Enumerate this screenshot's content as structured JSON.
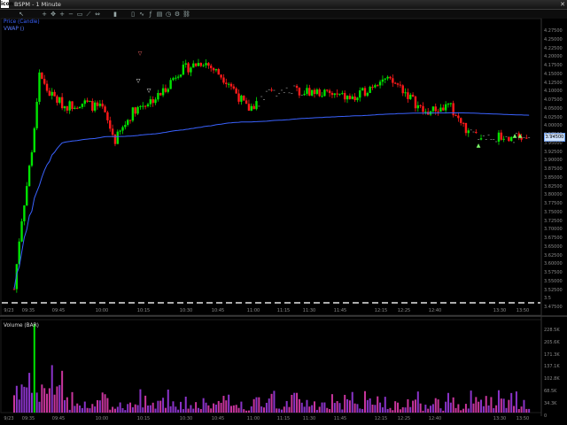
{
  "window": {
    "app_icon": "icon",
    "title": "BSPM - 1 Minute",
    "close_glyph": "✕"
  },
  "toolbar": {
    "icons": [
      "arrow-pointer-icon",
      "crosshair-icon",
      "pan-icon",
      "zoom-in-icon",
      "zoom-out-icon",
      "zoom-box-icon",
      "draw-line-icon",
      "fit-icon",
      "bar-style-icon",
      "candle-style-icon",
      "line-style-icon",
      "indicator-icon",
      "template-icon",
      "period-icon",
      "settings-icon",
      "link-icon"
    ],
    "glyphs": [
      "↖",
      "+",
      "✥",
      "+",
      "−",
      "▭",
      "⟋",
      "⇔",
      "▮",
      "▯",
      "∿",
      "ƒ",
      "▤",
      "◷",
      "⚙",
      "⛓"
    ]
  },
  "price_pane": {
    "study_label": "Price (Candle)",
    "vwap_label": "VWAP ()",
    "price_ticks": [
      "4.27500",
      "4.25000",
      "4.22500",
      "4.20000",
      "4.17500",
      "4.15000",
      "4.12500",
      "4.10000",
      "4.07500",
      "4.05000",
      "4.02500",
      "4.00000",
      "3.97500",
      "3.95000",
      "3.92500",
      "3.90000",
      "3.87500",
      "3.85000",
      "3.82500",
      "3.80000",
      "3.77500",
      "3.75000",
      "3.72500",
      "3.70000",
      "3.67500",
      "3.65000",
      "3.62500",
      "3.60000",
      "3.57500",
      "3.55000",
      "3.52500",
      "3.5",
      "3.47500"
    ],
    "time_ticks": [
      "9/23",
      "09:35",
      "09:45",
      "10:00",
      "10:15",
      "10:30",
      "10:45",
      "11:00",
      "11:15",
      "11:30",
      "11:45",
      "12:15",
      "12:25",
      "12:40",
      "13:30",
      "13:50"
    ],
    "last_price": "3.94500",
    "colors": {
      "up": "#00e400",
      "down": "#ff1a1a",
      "vwap": "#3a62ff",
      "line": "#e6e6e6"
    }
  },
  "volume_pane": {
    "label": "Volume (BAR)",
    "vol_ticks": [
      "228.5K",
      "205.6K",
      "171.3K",
      "137.1K",
      "102.8K",
      "68.5K",
      "34.3K",
      "0"
    ],
    "time_ticks": [
      "9/23",
      "09:35",
      "09:45",
      "10:00",
      "10:15",
      "10:30",
      "10:45",
      "11:00",
      "11:15",
      "11:30",
      "11:45",
      "12:15",
      "12:25",
      "12:40",
      "13:30",
      "13:50"
    ]
  }
}
